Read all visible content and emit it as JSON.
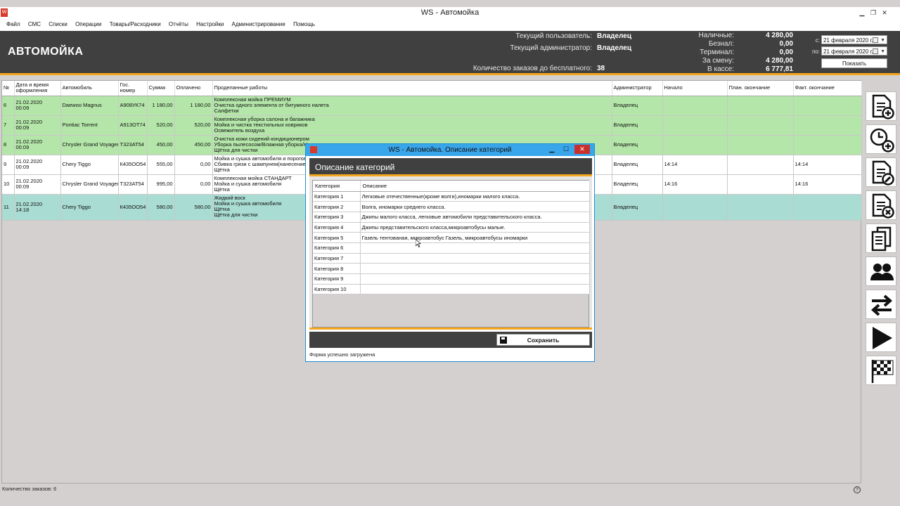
{
  "window": {
    "title": "WS - Автомойка",
    "app_icon": "ws-app-icon"
  },
  "menu": [
    "Файл",
    "СМС",
    "Списки",
    "Операции",
    "Товары/Расходники",
    "Отчёты",
    "Настройки",
    "Администрирование",
    "Помощь"
  ],
  "header": {
    "brand": "АВТОМОЙКА",
    "user_label": "Текущий пользователь:",
    "user_value": "Владелец",
    "admin_label": "Текущий администратор:",
    "admin_value": "Владелец",
    "free_label": "Количество заказов до бесплатного:",
    "free_value": "38",
    "cash_label": "Наличные:",
    "cash_value": "4 280,00",
    "noncash_label": "Безнал:",
    "noncash_value": "0,00",
    "terminal_label": "Терминал:",
    "terminal_value": "0,00",
    "shift_label": "За смену:",
    "shift_value": "4 280,00",
    "till_label": "В кассе:",
    "till_value": "6 777,81",
    "from_label": "с:",
    "from_date": "21 февраля 2020 г.",
    "to_label": "по:",
    "to_date": "21 февраля 2020 г.",
    "show_button": "Показать"
  },
  "orders": {
    "columns": [
      "№",
      "Дата и время оформления",
      "Автомобиль",
      "Гос. номер",
      "Сумма",
      "Оплачено",
      "Проделанные работы",
      "Администратор",
      "Начало",
      "План. окончание",
      "Факт. окончание"
    ],
    "rows": [
      {
        "status": "green",
        "no": "6",
        "date": "21.02.2020",
        "time": "00:09",
        "car": "Daewoo Magnus",
        "plate": "А908УК74",
        "sum": "1 180,00",
        "paid": "1 180,00",
        "works": "Комплексная мойка ПРЕМИУМ\nОчистка одного элемента от битумного налета\nСалфетки",
        "admin": "Владелец",
        "start": "",
        "plan_end": "",
        "fact_end": ""
      },
      {
        "status": "green",
        "no": "7",
        "date": "21.02.2020",
        "time": "00:09",
        "car": "Pontiac Torrent",
        "plate": "А913ОТ74",
        "sum": "520,00",
        "paid": "520,00",
        "works": "Комплексная уборка салона и багажника\nМойка и чистка текстильных ковриков\nОсвежитель воздуха",
        "admin": "Владелец",
        "start": "",
        "plan_end": "",
        "fact_end": ""
      },
      {
        "status": "green",
        "no": "8",
        "date": "21.02.2020",
        "time": "00:09",
        "car": "Chrysler Grand Voyager",
        "plate": "Т323АТ54",
        "sum": "450,00",
        "paid": "450,00",
        "works": "Очистка кожи сидений кондиционером\nУборка пылесосом/Влажная уборка/Н\nЩётка для чистки",
        "admin": "Владелец",
        "start": "",
        "plan_end": "",
        "fact_end": ""
      },
      {
        "status": "white",
        "no": "9",
        "date": "21.02.2020",
        "time": "00:09",
        "car": "Chery Tiggo",
        "plate": "К435ОО54",
        "sum": "555,00",
        "paid": "0,00",
        "works": "Мойка и сушка автомобиля и порогов\nСбивка грязи с шампунем(нанесение и\nЩётка",
        "admin": "Владелец",
        "start": "14:14",
        "plan_end": "",
        "fact_end": "14:14"
      },
      {
        "status": "white",
        "no": "10",
        "date": "21.02.2020",
        "time": "00:09",
        "car": "Chrysler Grand Voyager",
        "plate": "Т323АТ54",
        "sum": "995,00",
        "paid": "0,00",
        "works": "Комплексная мойка СТАНДАРТ\nМойка и сушка автомобиля\nЩётка",
        "admin": "Владелец",
        "start": "14:16",
        "plan_end": "",
        "fact_end": "14:16"
      },
      {
        "status": "teal",
        "no": "11",
        "date": "21.02.2020",
        "time": "14:18",
        "car": "Chery Tiggo",
        "plate": "К435ОО54",
        "sum": "580,00",
        "paid": "580,00",
        "works": "Жидкий воск\nМойка и сушка автомобиля\nЩётка\nЩётка для чистки",
        "admin": "Владелец",
        "start": "",
        "plan_end": "",
        "fact_end": ""
      }
    ],
    "count_label": "Количество заказов: 6"
  },
  "sidebar_icons": [
    "new-order-icon",
    "scheduled-order-icon",
    "edit-order-icon",
    "delete-order-icon",
    "report-icon",
    "clients-icon",
    "transfer-icon",
    "start-icon",
    "finish-flag-icon"
  ],
  "dialog": {
    "title": "WS - Автомойка. Описание категорий",
    "heading": "Описание категорий",
    "columns": [
      "Категория",
      "Описание"
    ],
    "rows": [
      {
        "cat": "Категория 1",
        "desc": "Легковые отечественные(кроме волги),иномарки малого класса."
      },
      {
        "cat": "Категория 2",
        "desc": "Волга, иномарки среднего класса."
      },
      {
        "cat": "Категория 3",
        "desc": "Джипы малого класса, легковые автомобили представительского класса."
      },
      {
        "cat": "Категория 4",
        "desc": "Джипы представительского класса,микроавтобусы малые."
      },
      {
        "cat": "Категория 5",
        "desc": "Газель тентованая, микроавтобус Газель, микроавтобусы иномарки"
      },
      {
        "cat": "Категория 6",
        "desc": ""
      },
      {
        "cat": "Категория 7",
        "desc": ""
      },
      {
        "cat": "Категория 8",
        "desc": ""
      },
      {
        "cat": "Категория 9",
        "desc": ""
      },
      {
        "cat": "Категория 10",
        "desc": ""
      }
    ],
    "save_button": "Сохранить",
    "status": "Форма успешно загружена"
  },
  "colors": {
    "accent": "#f4a61d",
    "header_bg": "#404040",
    "row_done": "#b4e6a9",
    "row_current": "#a9dcd2",
    "dialog_title": "#3aa6ea"
  }
}
